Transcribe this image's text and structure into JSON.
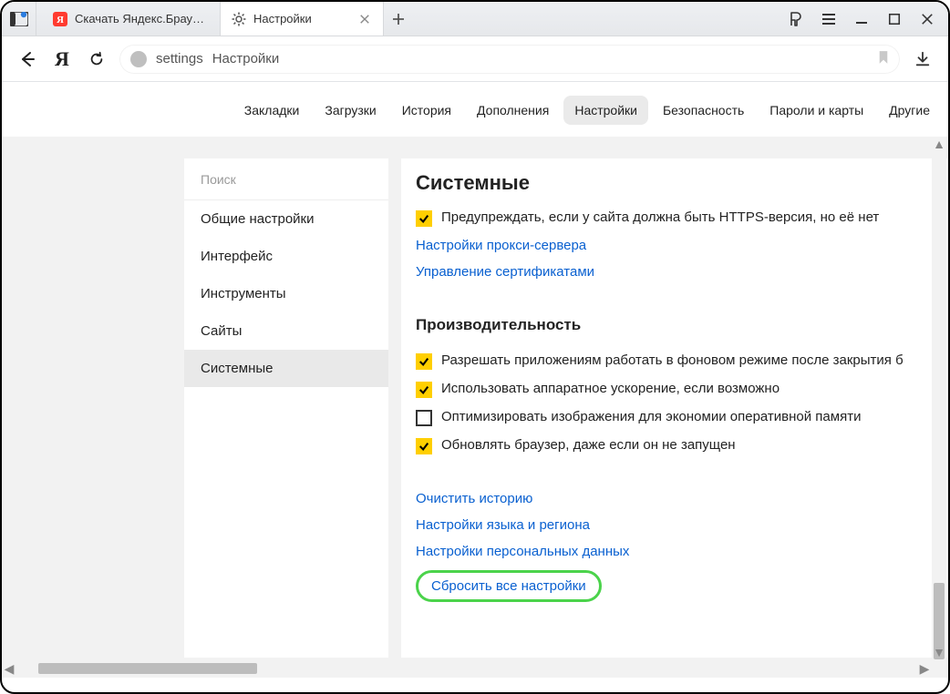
{
  "titlebar": {
    "tabs": [
      {
        "title": "Скачать Яндекс.Браузер д",
        "active": false
      },
      {
        "title": "Настройки",
        "active": true
      }
    ]
  },
  "address": {
    "protocol_label": "settings",
    "page_label": "Настройки"
  },
  "topnav": {
    "items": [
      {
        "label": "Закладки",
        "active": false
      },
      {
        "label": "Загрузки",
        "active": false
      },
      {
        "label": "История",
        "active": false
      },
      {
        "label": "Дополнения",
        "active": false
      },
      {
        "label": "Настройки",
        "active": true
      },
      {
        "label": "Безопасность",
        "active": false
      },
      {
        "label": "Пароли и карты",
        "active": false
      },
      {
        "label": "Другие",
        "active": false
      }
    ]
  },
  "sidebar": {
    "search_placeholder": "Поиск",
    "items": [
      {
        "label": "Общие настройки",
        "active": false
      },
      {
        "label": "Интерфейс",
        "active": false
      },
      {
        "label": "Инструменты",
        "active": false
      },
      {
        "label": "Сайты",
        "active": false
      },
      {
        "label": "Системные",
        "active": true
      }
    ]
  },
  "content": {
    "section_system_title": "Системные",
    "https_warn": {
      "label": "Предупреждать, если у сайта должна быть HTTPS-версия, но её нет",
      "checked": true
    },
    "proxy_link": "Настройки прокси-сервера",
    "cert_link": "Управление сертификатами",
    "perf_title": "Производительность",
    "perf_bg": {
      "label": "Разрешать приложениям работать в фоновом режиме после закрытия б",
      "checked": true
    },
    "perf_hw": {
      "label": "Использовать аппаратное ускорение, если возможно",
      "checked": true
    },
    "perf_img": {
      "label": "Оптимизировать изображения для экономии оперативной памяти",
      "checked": false
    },
    "perf_upd": {
      "label": "Обновлять браузер, даже если он не запущен",
      "checked": true
    },
    "clear_history_link": "Очистить историю",
    "lang_region_link": "Настройки языка и региона",
    "personal_data_link": "Настройки персональных данных",
    "reset_all_link": "Сбросить все настройки"
  }
}
